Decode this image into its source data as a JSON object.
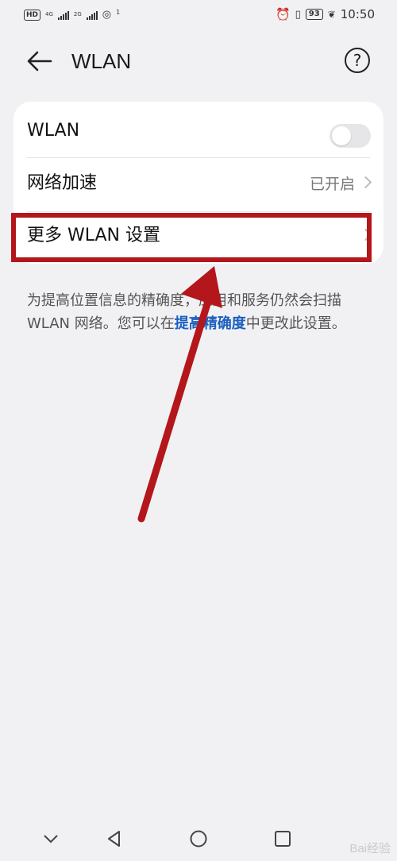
{
  "status_bar": {
    "hd": "HD",
    "sim1_network": "4G",
    "sim2_network": "2G",
    "hotspot_count": "1",
    "battery": "93",
    "time": "10:50"
  },
  "header": {
    "title": "WLAN"
  },
  "settings": {
    "wlan_label": "WLAN",
    "wlan_enabled": false,
    "accel_label": "网络加速",
    "accel_value": "已开启",
    "more_label": "更多 WLAN 设置"
  },
  "note": {
    "text_before": "为提高位置信息的精确度，应用和服务仍然会扫描 WLAN 网络。您可以在",
    "link": "提高精确度",
    "text_after": "中更改此设置。"
  },
  "colors": {
    "annotation_red": "#b3161b",
    "link_blue": "#1a5fbf",
    "background": "#f1f1f3"
  },
  "watermark": "Bai经验"
}
